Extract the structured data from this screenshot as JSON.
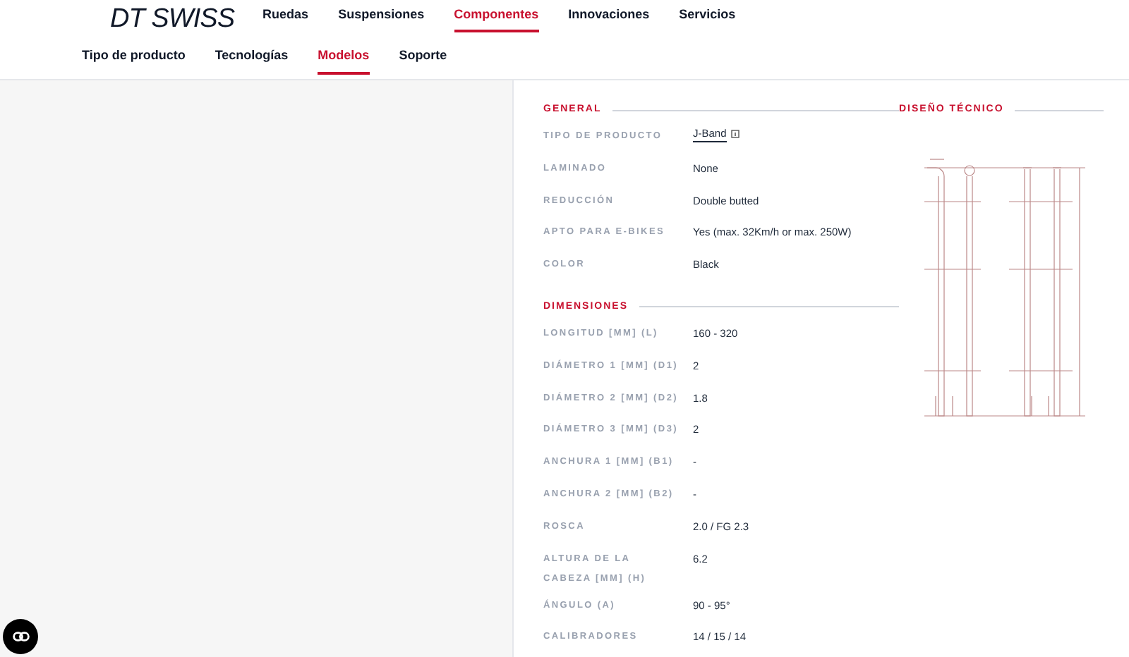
{
  "brand": {
    "logo": "DT SWISS"
  },
  "main_nav": [
    {
      "label": "Ruedas",
      "selected": false
    },
    {
      "label": "Suspensiones",
      "selected": false
    },
    {
      "label": "Componentes",
      "selected": true
    },
    {
      "label": "Innovaciones",
      "selected": false
    },
    {
      "label": "Servicios",
      "selected": false
    }
  ],
  "sub_nav": [
    {
      "label": "Tipo de producto",
      "selected": false
    },
    {
      "label": "Tecnologías",
      "selected": false
    },
    {
      "label": "Modelos",
      "selected": true
    },
    {
      "label": "Soporte",
      "selected": false
    }
  ],
  "sections": [
    {
      "title": "GENERAL",
      "rows": [
        {
          "label": "TIPO DE PRODUCTO",
          "value": "J-Band",
          "kind": "link"
        },
        {
          "label": "LAMINADO",
          "value": "None",
          "kind": "text"
        },
        {
          "label": "REDUCCIÓN",
          "value": "Double butted",
          "kind": "text"
        },
        {
          "label": "APTO PARA E-BIKES",
          "value": "Yes (max. 32Km/h or max. 250W)",
          "kind": "text"
        },
        {
          "label": "COLOR",
          "value": "Black",
          "kind": "text"
        }
      ]
    },
    {
      "title": "DIMENSIONES",
      "rows": [
        {
          "label": "LONGITUD [MM] (L)",
          "value": "160 - 320",
          "kind": "text"
        },
        {
          "label": "DIÁMETRO 1 [MM] (D1)",
          "value": "2",
          "kind": "text"
        },
        {
          "label": "DIÁMETRO 2 [MM] (D2)",
          "value": "1.8",
          "kind": "text"
        },
        {
          "label": "DIÁMETRO 3 [MM] (D3)",
          "value": "2",
          "kind": "text"
        },
        {
          "label": "ANCHURA 1 [MM] (B1)",
          "value": "-",
          "kind": "text"
        },
        {
          "label": "ANCHURA 2 [MM] (B2)",
          "value": "-",
          "kind": "text"
        },
        {
          "label": "ROSCA",
          "value": "2.0 / FG 2.3",
          "kind": "text"
        },
        {
          "label": "ALTURA DE LA CABEZA [MM] (H)",
          "value": "6.2",
          "kind": "text"
        },
        {
          "label": "ÁNGULO (A)",
          "value": "90 - 95°",
          "kind": "text"
        },
        {
          "label": "CALIBRADORES",
          "value": "14 / 15 / 14",
          "kind": "text"
        }
      ]
    }
  ],
  "drawing": {
    "title": "DISEÑO TÉCNICO"
  }
}
